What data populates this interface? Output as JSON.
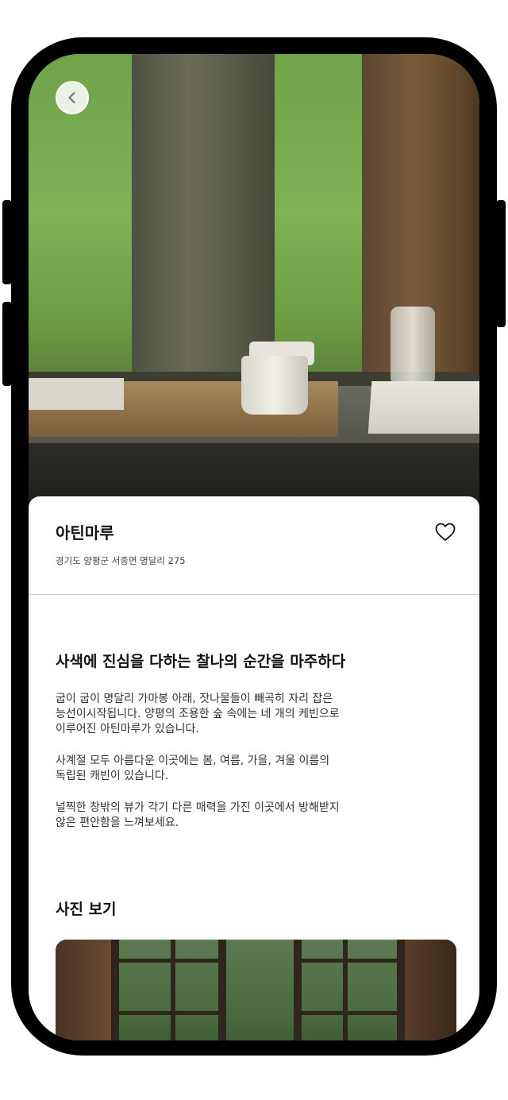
{
  "header": {
    "back_icon": "chevron-left-icon"
  },
  "place": {
    "name": "아틴마루",
    "address": "경기도 양평군 서종면 명달리 275",
    "favorite_icon": "heart-outline-icon"
  },
  "description": {
    "headline": "사색에 진심을 다하는 찰나의 순간을 마주하다",
    "paragraphs": [
      [
        "굽이 굽이 명달리 가마봉 아래, 잣나물들이 빼곡히 자리 잡은",
        "능선이시작됩니다. 양평의 조용한 숲 속에는 네 개의 케빈으로",
        "이루어진 아틴마루가 있습니다."
      ],
      [
        "사계절 모두 아름다운 이곳에는 봄, 여름, 가을, 겨울 이름의",
        "독립된 캐빈이 있습니다."
      ],
      [
        "널찍한 창밖의 뷰가 각기 다른 매력을 가진 이곳에서 방해받지",
        "않은 편안함을 느껴보세요."
      ]
    ]
  },
  "photos": {
    "section_title": "사진 보기"
  },
  "colors": {
    "device_frame": "#000000",
    "text_primary": "#111111",
    "text_secondary": "#444444",
    "divider": "#cfcfcf"
  }
}
